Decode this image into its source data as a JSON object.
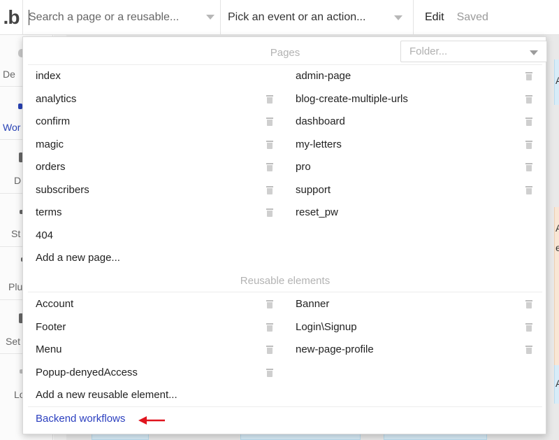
{
  "topbar": {
    "logo": ".b",
    "search_placeholder": "Search a page or a reusable...",
    "event_placeholder": "Pick an event or an action...",
    "edit_label": "Edit",
    "saved_label": "Saved"
  },
  "sidebar": {
    "items": [
      {
        "label": "De",
        "active": false
      },
      {
        "label": "Wor",
        "active": true
      },
      {
        "label": "D",
        "active": false
      },
      {
        "label": "St",
        "active": false
      },
      {
        "label": "Plu",
        "active": false
      },
      {
        "label": "Set",
        "active": false
      },
      {
        "label": "Lo",
        "active": false
      }
    ]
  },
  "panel": {
    "pages_title": "Pages",
    "folder_placeholder": "Folder...",
    "pages_left": [
      {
        "label": "index",
        "deletable": false
      },
      {
        "label": "analytics",
        "deletable": true
      },
      {
        "label": "confirm",
        "deletable": true
      },
      {
        "label": "magic",
        "deletable": true
      },
      {
        "label": "orders",
        "deletable": true
      },
      {
        "label": "subscribers",
        "deletable": true
      },
      {
        "label": "terms",
        "deletable": true
      },
      {
        "label": "404",
        "deletable": false
      }
    ],
    "pages_right": [
      {
        "label": "admin-page",
        "deletable": true
      },
      {
        "label": "blog-create-multiple-urls",
        "deletable": true
      },
      {
        "label": "dashboard",
        "deletable": true
      },
      {
        "label": "my-letters",
        "deletable": true
      },
      {
        "label": "pro",
        "deletable": true
      },
      {
        "label": "support",
        "deletable": true
      },
      {
        "label": "reset_pw",
        "deletable": false
      }
    ],
    "add_page": "Add a new page...",
    "reusable_title": "Reusable elements",
    "reusable_left": [
      {
        "label": "Account",
        "deletable": true
      },
      {
        "label": "Footer",
        "deletable": true
      },
      {
        "label": "Menu",
        "deletable": true
      },
      {
        "label": "Popup-denyedAccess",
        "deletable": true
      }
    ],
    "reusable_right": [
      {
        "label": "Banner",
        "deletable": true
      },
      {
        "label": "Login\\Signup",
        "deletable": true
      },
      {
        "label": "new-page-profile",
        "deletable": true
      }
    ],
    "add_reusable": "Add a new reusable element...",
    "backend_workflows": "Backend workflows"
  },
  "canvas_right_letters": [
    "A",
    "A",
    "e",
    "A"
  ],
  "colors": {
    "accent": "#2b3fbf",
    "arrow": "#e0141e",
    "section_title": "#b3b3b3"
  }
}
